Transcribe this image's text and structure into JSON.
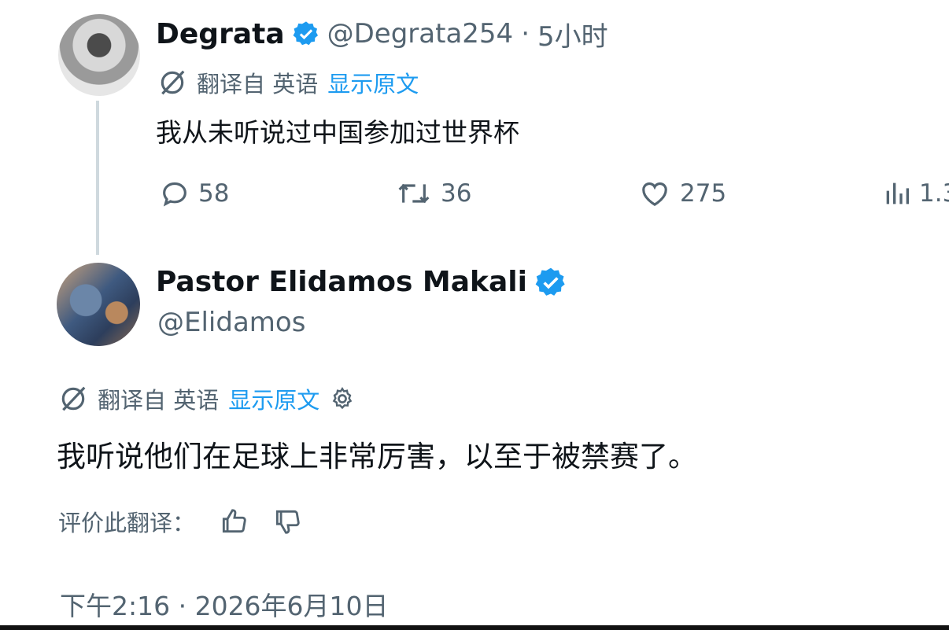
{
  "tweet": {
    "author_name": "Degrata",
    "handle": "@Degrata254",
    "separator": "·",
    "time_ago": "5小时",
    "translated_from": "翻译自 英语",
    "show_original": "显示原文",
    "text": "我从未听说过中国参加过世界杯",
    "replies": "58",
    "retweets": "36",
    "likes": "275",
    "views": "1.3"
  },
  "reply": {
    "author_name": "Pastor Elidamos Makali",
    "handle": "@Elidamos",
    "translated_from": "翻译自 英语",
    "show_original": "显示原文",
    "text": "我听说他们在足球上非常厉害，以至于被禁赛了。",
    "rate_translation": "评价此翻译：",
    "timestamp": "下午2:16 · 2026年6月10日"
  },
  "colors": {
    "accent": "#1d9bf0",
    "muted": "#536471",
    "text": "#0f1419"
  },
  "icons": [
    "verified-badge-icon",
    "translate-icon",
    "reply-icon",
    "retweet-icon",
    "like-icon",
    "views-icon",
    "settings-gear-icon",
    "thumbs-up-icon",
    "thumbs-down-icon"
  ]
}
